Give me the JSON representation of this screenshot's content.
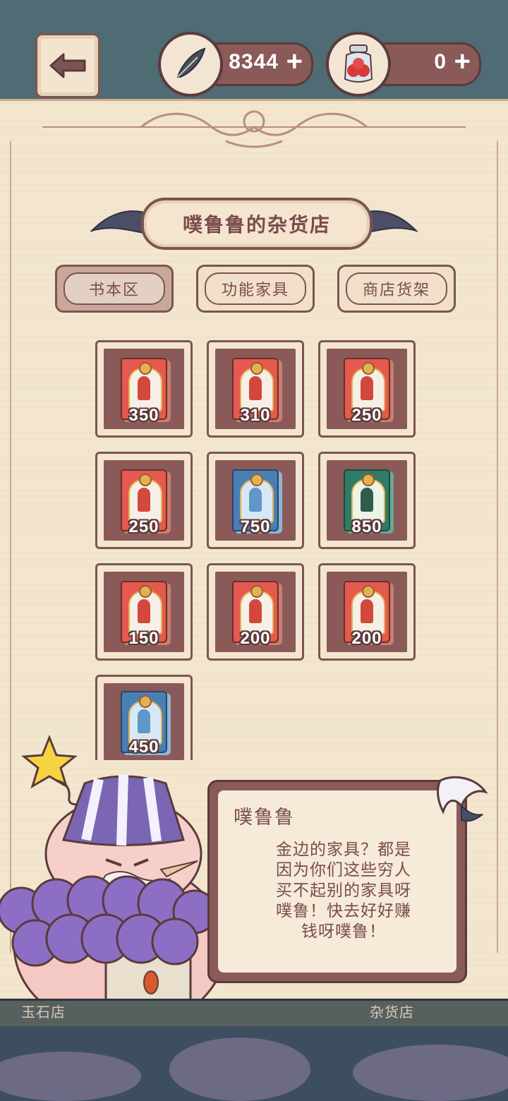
{
  "topbar": {
    "feathers": {
      "value": "8344",
      "plus": "+"
    },
    "jars": {
      "value": "0",
      "plus": "+"
    }
  },
  "shop": {
    "title": "噗鲁鲁的杂货店",
    "tabs": [
      {
        "label": "书本区",
        "active": true
      },
      {
        "label": "功能家具",
        "active": false
      },
      {
        "label": "商店货架",
        "active": false
      }
    ],
    "items": [
      {
        "price": "350",
        "color": "red"
      },
      {
        "price": "310",
        "color": "red"
      },
      {
        "price": "250",
        "color": "red"
      },
      {
        "price": "250",
        "color": "red"
      },
      {
        "price": "750",
        "color": "blue"
      },
      {
        "price": "850",
        "color": "green"
      },
      {
        "price": "150",
        "color": "red"
      },
      {
        "price": "200",
        "color": "red"
      },
      {
        "price": "200",
        "color": "red"
      },
      {
        "price": "450",
        "color": "blue"
      }
    ]
  },
  "dialog": {
    "speaker": "噗鲁鲁",
    "lines": [
      "金边的家具？都是",
      "因为你们这些穷人",
      "买不起别的家具呀",
      "噗鲁！快去好好赚",
      "钱呀噗鲁！"
    ]
  },
  "street": {
    "left_shop": "玉石店",
    "right_shop": "杂货店"
  },
  "colors": {
    "frame": "#7a5650",
    "slot_fill": "#8a5a58",
    "parchment": "#f3e6cf",
    "text": "#7a4c4b"
  }
}
